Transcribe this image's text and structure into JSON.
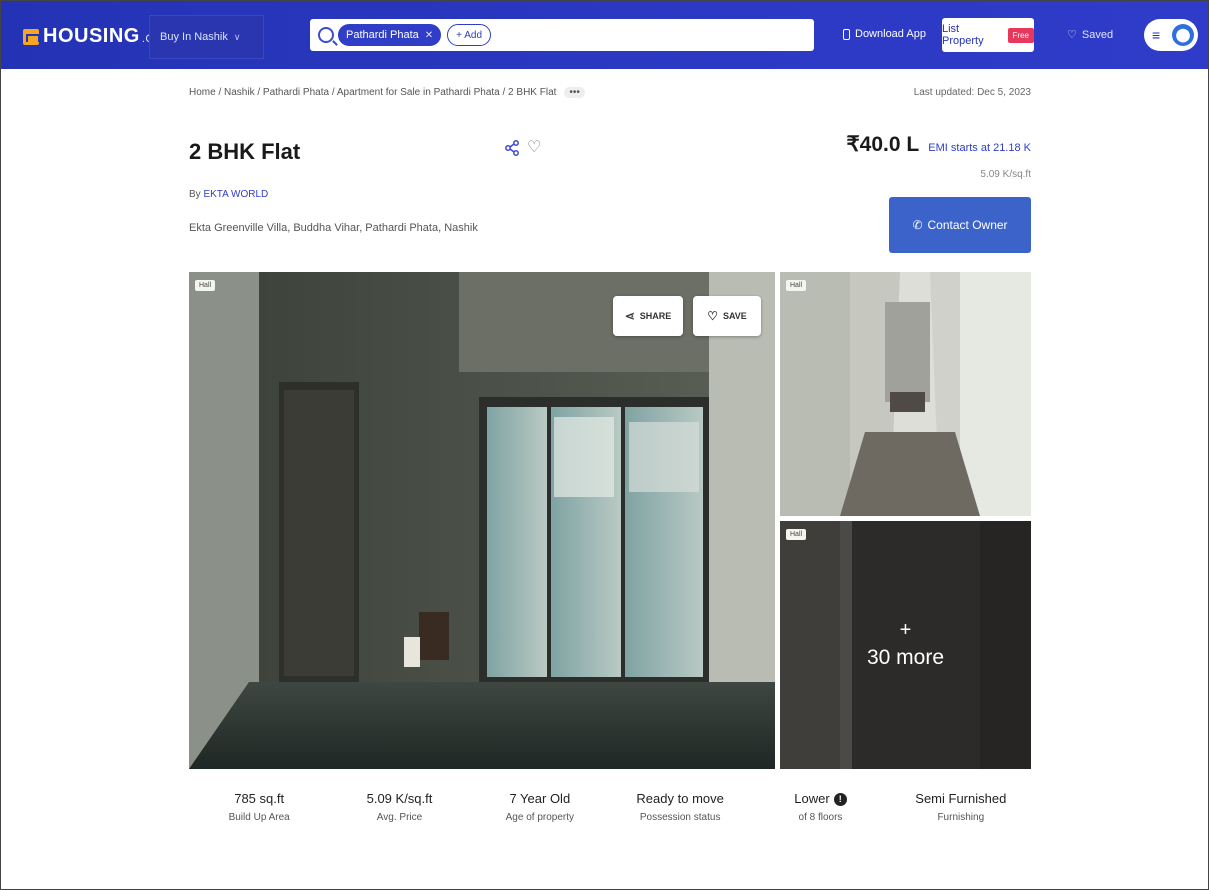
{
  "nav": {
    "logo_text": "HOUSING",
    "logo_suffix": ".COM",
    "buy_in": "Buy In Nashik",
    "search_chip": "Pathardi Phata",
    "search_add": "+ Add",
    "download_app": "Download App",
    "list_property": "List Property",
    "free_badge": "Free",
    "saved": "Saved"
  },
  "breadcrumb": "Home / Nashik / Pathardi Phata / Apartment for Sale in Pathardi Phata / 2 BHK Flat",
  "breadcrumb_more": "•••",
  "last_updated": "Last updated: Dec 5, 2023",
  "listing": {
    "title": "2 BHK Flat",
    "by_prefix": "By",
    "builder": "EKTA WORLD",
    "address": "Ekta Greenville Villa, Buddha Vihar, Pathardi Phata, Nashik",
    "price": "₹40.0 L",
    "emi": "EMI starts at  21.18 K",
    "per_sqft": "5.09 K/sq.ft",
    "contact_label": "Contact Owner"
  },
  "gallery": {
    "main_tag": "Hall",
    "side1_tag": "Hall",
    "side2_tag": "Hall",
    "share_label": "SHARE",
    "save_label": "SAVE",
    "more_plus": "+",
    "more_label": "30 more"
  },
  "stats": [
    {
      "value": "785 sq.ft",
      "label": "Build Up Area"
    },
    {
      "value": "5.09 K/sq.ft",
      "label": "Avg. Price"
    },
    {
      "value": "7 Year Old",
      "label": "Age of property"
    },
    {
      "value": "Ready to move",
      "label": "Possession status"
    },
    {
      "value": "Lower",
      "label": "of 8 floors"
    },
    {
      "value": "Semi Furnished",
      "label": "Furnishing"
    }
  ],
  "colors": {
    "nav_bg": "#2433b5",
    "accent": "#2f3dc7",
    "contact_btn": "#3b63c9",
    "free_badge": "#e8365d"
  }
}
